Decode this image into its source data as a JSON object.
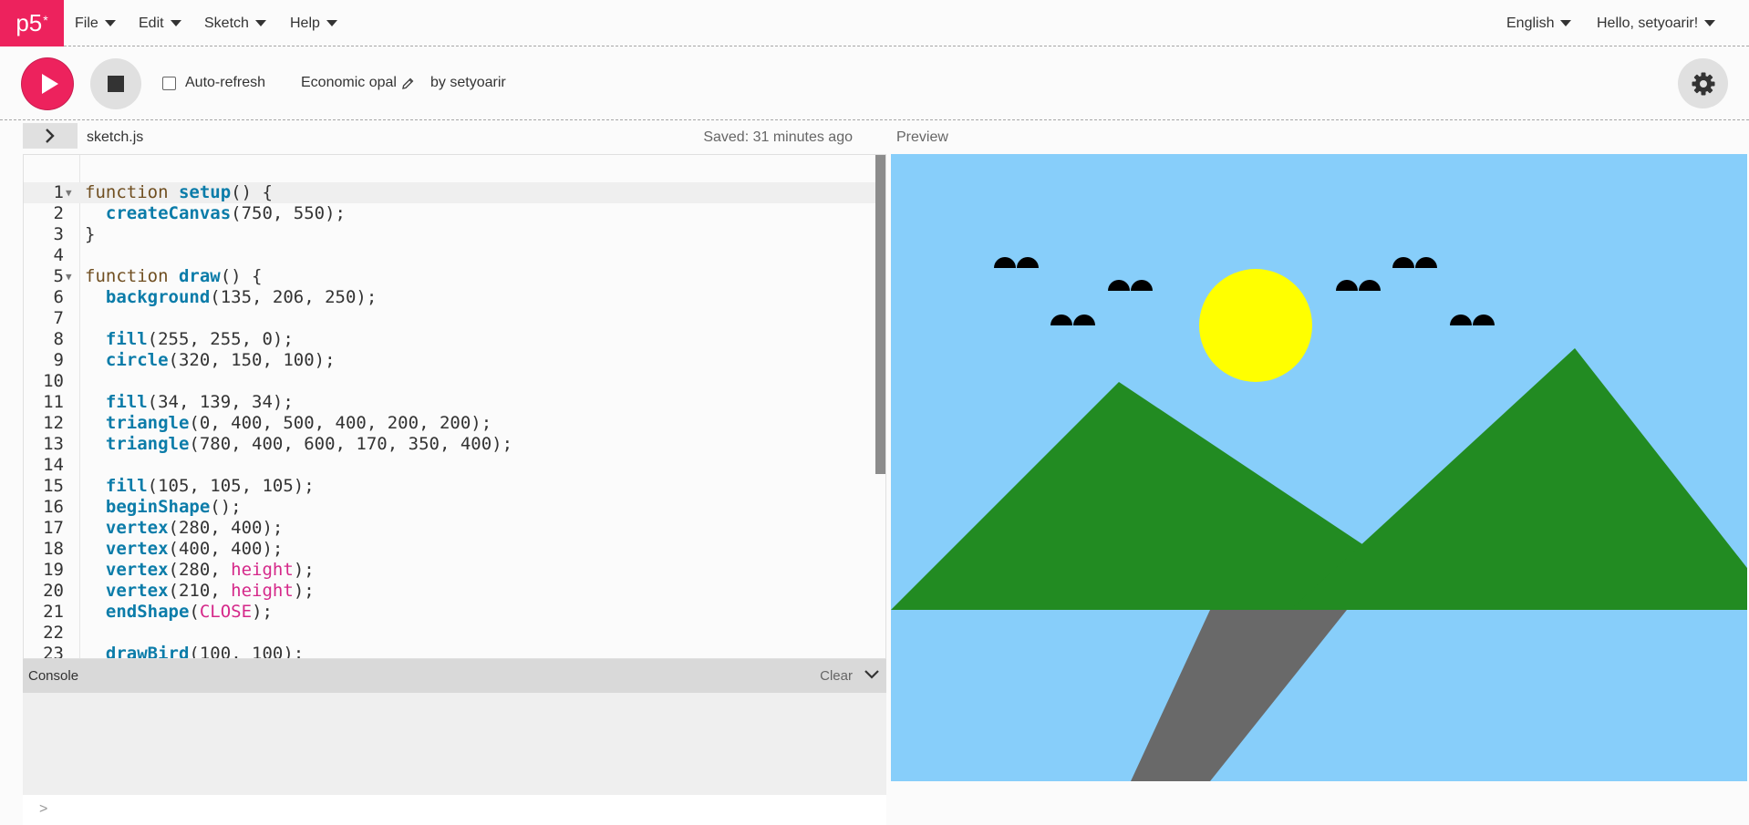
{
  "nav": {
    "logo": "p5",
    "logo_sup": "*",
    "menus": [
      "File",
      "Edit",
      "Sketch",
      "Help"
    ],
    "language": "English",
    "user_greeting": "Hello, setyoarir!"
  },
  "toolbar": {
    "auto_refresh_label": "Auto-refresh",
    "sketch_name": "Economic opal",
    "byline": "by setyoarir"
  },
  "editor": {
    "filename": "sketch.js",
    "saved_status": "Saved: 31 minutes ago",
    "lines": [
      "1",
      "2",
      "3",
      "4",
      "5",
      "6",
      "7",
      "8",
      "9",
      "10",
      "11",
      "12",
      "13",
      "14",
      "15",
      "16",
      "17",
      "18",
      "19",
      "20",
      "21",
      "22",
      "23"
    ]
  },
  "preview": {
    "label": "Preview",
    "colors": {
      "sky": "#87cefa",
      "sun": "#ffff00",
      "mountain": "#228b22",
      "road": "#696969",
      "bird": "#000000"
    }
  },
  "console": {
    "title": "Console",
    "clear_label": "Clear",
    "prompt": ">"
  },
  "colors": {
    "accent": "#ed225d",
    "keyword": "#704f21",
    "function": "#0b7ca9",
    "constant": "#d52889"
  }
}
